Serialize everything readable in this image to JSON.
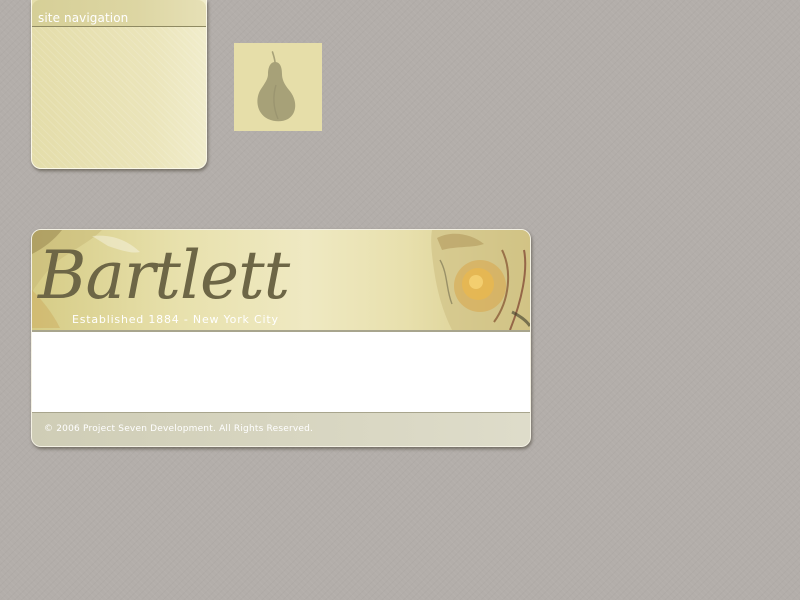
{
  "navigation": {
    "heading": "site navigation"
  },
  "logo_tile": {
    "icon": "pear-icon",
    "background_color": "#e6dea9",
    "icon_color": "#a7a178"
  },
  "banner": {
    "brand_name": "Bartlett",
    "tagline": "Established 1884 - New York City"
  },
  "content": {
    "text": ""
  },
  "footer": {
    "copyright": "© 2006 Project Seven Development. All Rights Reserved."
  },
  "colors": {
    "page_background": "#b3aeaa",
    "panel_cream": "#e9e3b4",
    "brand_text": "#6d6646",
    "footer_band": "#d7d5c0"
  }
}
